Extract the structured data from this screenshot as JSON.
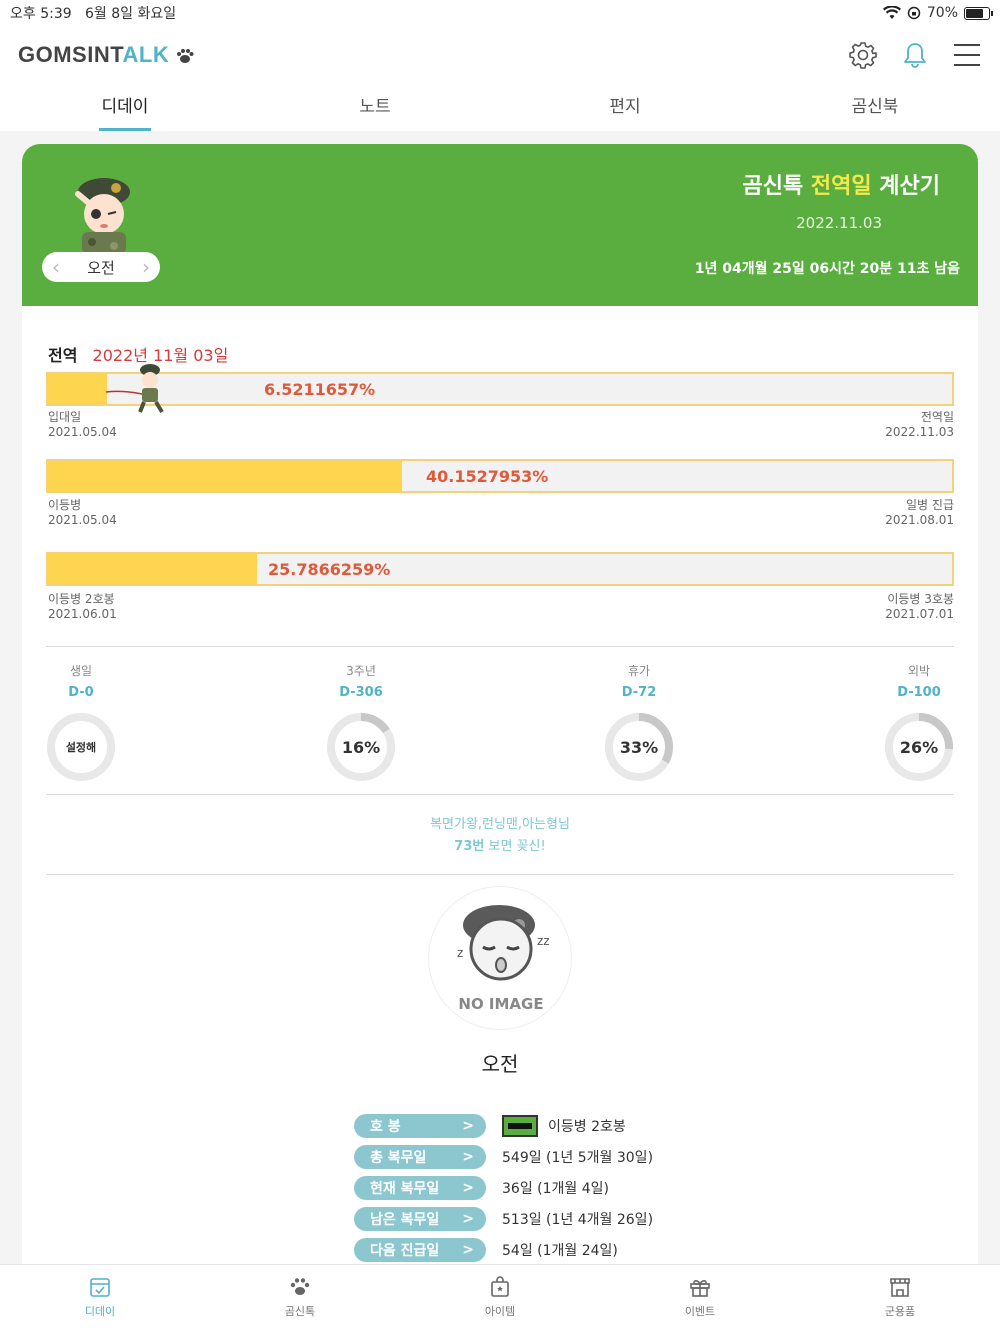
{
  "status": {
    "time": "오후 5:39",
    "date": "6월 8일 화요일",
    "battery": "70%"
  },
  "header": {
    "logo_main": "GOMSINT",
    "logo_accent": "ALK",
    "logo_icon": "paw-icon"
  },
  "tabs": [
    {
      "label": "디데이",
      "active": true
    },
    {
      "label": "노트"
    },
    {
      "label": "편지"
    },
    {
      "label": "곰신북"
    }
  ],
  "banner": {
    "title_prefix": "곰신톡 ",
    "title_highlight": "전역일",
    "title_suffix": " 계산기",
    "date": "2022.11.03",
    "remaining": "1년 04개월 25일 06시간 20분 11초 남음",
    "name": "오전"
  },
  "discharge": {
    "label": "전역",
    "date": "2022년 11월 03일"
  },
  "bars": [
    {
      "percent_text": "6.5211657%",
      "fill": 0.065,
      "left_label": "입대일",
      "left_date": "2021.05.04",
      "right_label": "전역일",
      "right_date": "2022.11.03"
    },
    {
      "percent_text": "40.1527953%",
      "fill": 0.3915,
      "left_label": "이등병",
      "left_date": "2021.05.04",
      "right_label": "일병 진급",
      "right_date": "2021.08.01"
    },
    {
      "percent_text": "25.7866259%",
      "fill": 0.2309,
      "left_label": "이등병 2호봉",
      "left_date": "2021.06.01",
      "right_label": "이등병 3호봉",
      "right_date": "2021.07.01"
    }
  ],
  "ddays": [
    {
      "title": "생일",
      "dday": "D-0",
      "center": "설정해",
      "percent": 0
    },
    {
      "title": "3주년",
      "dday": "D-306",
      "center": "16%",
      "percent": 16
    },
    {
      "title": "휴가",
      "dday": "D-72",
      "center": "33%",
      "percent": 33
    },
    {
      "title": "외박",
      "dday": "D-100",
      "center": "26%",
      "percent": 26
    }
  ],
  "quote": {
    "line1": "복면가왕,런닝맨,아는형님",
    "line2_bold": "73번",
    "line2_rest": " 보면 꽂신!"
  },
  "profile": {
    "no_image": "NO IMAGE",
    "name": "오전"
  },
  "info": [
    {
      "label": "호 봉",
      "value": "이등병 2호봉"
    },
    {
      "label": "총 복무일",
      "value": "549일 (1년 5개월 30일)"
    },
    {
      "label": "현재 복무일",
      "value": "36일 (1개월 4일)"
    },
    {
      "label": "남은 복무일",
      "value": "513일 (1년 4개월 26일)"
    },
    {
      "label": "다음 진급일",
      "value": "54일 (1개월 24일)"
    }
  ],
  "bottom_nav": [
    {
      "label": "디데이",
      "icon": "calendar-check-icon",
      "active": true
    },
    {
      "label": "곰신톡",
      "icon": "paw-icon"
    },
    {
      "label": "아이템",
      "icon": "shopping-bag-icon"
    },
    {
      "label": "이벤트",
      "icon": "gift-icon"
    },
    {
      "label": "군용품",
      "icon": "store-icon"
    }
  ],
  "colors": {
    "accent": "#4fb3c9",
    "green": "#5aae3f",
    "bar_fill": "#fdd54e",
    "percent": "#e05a3a",
    "red": "#d63a3a"
  }
}
